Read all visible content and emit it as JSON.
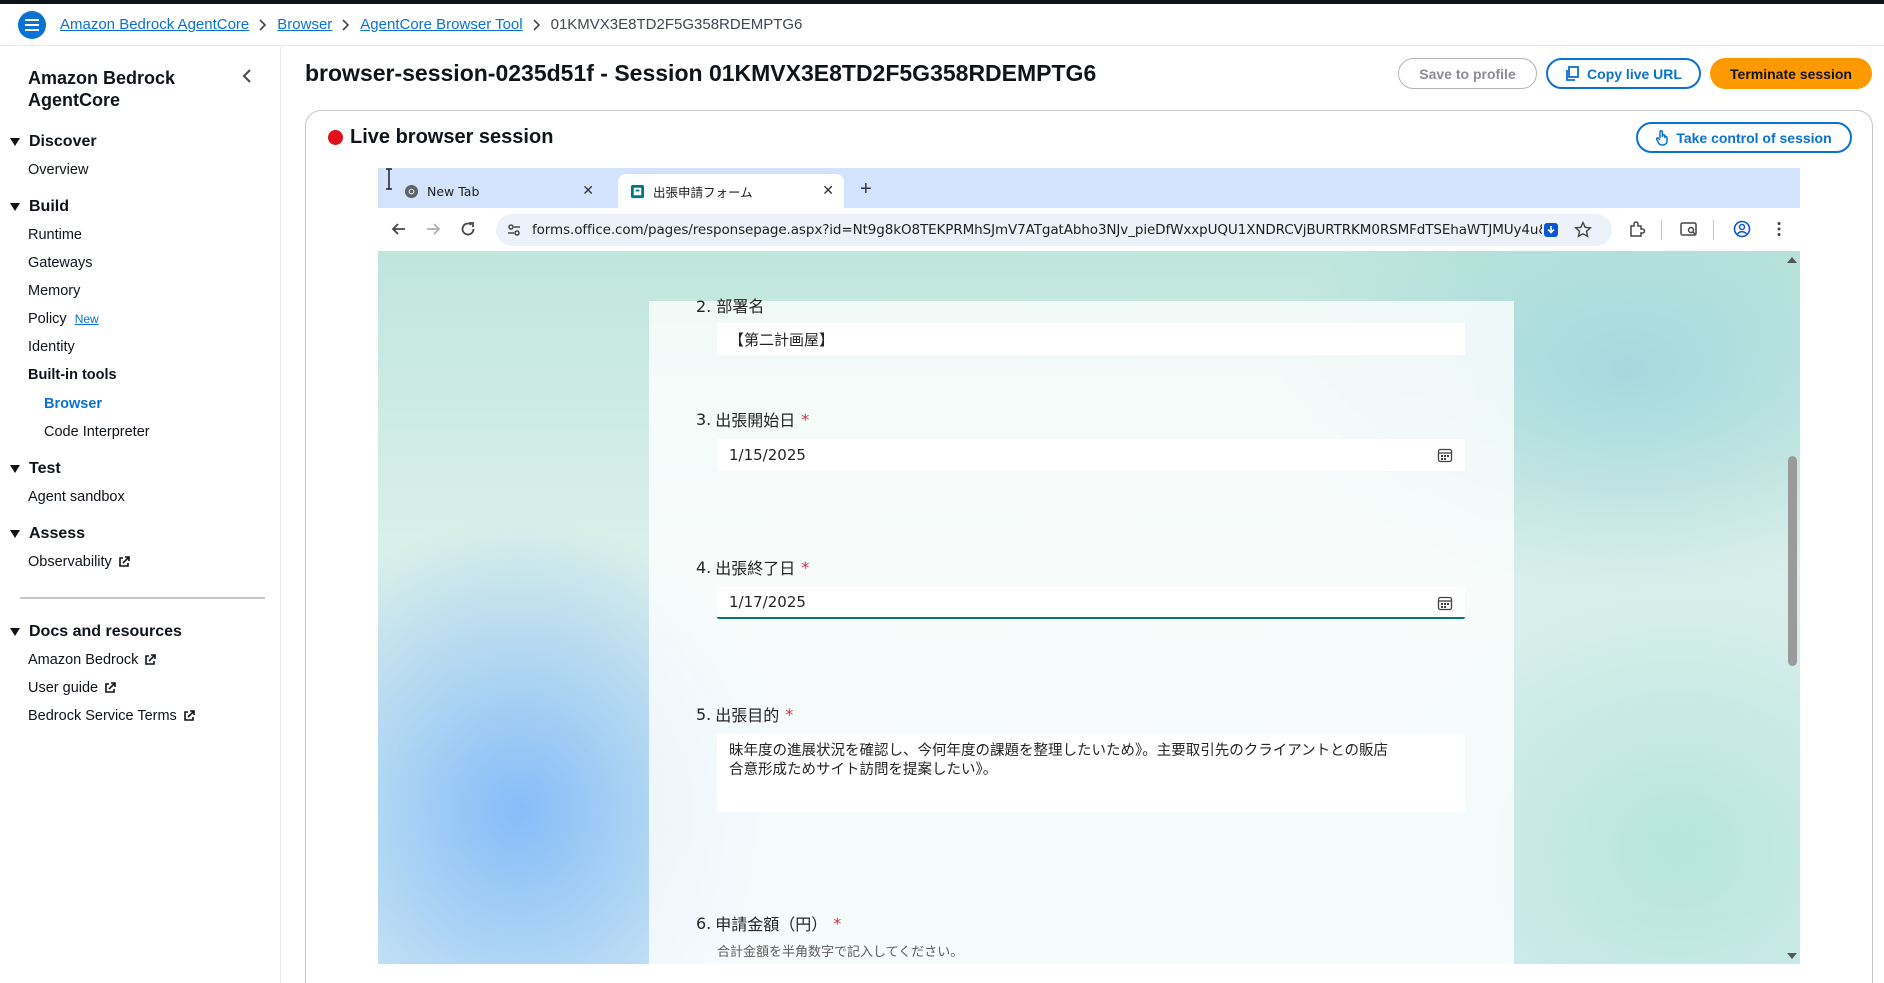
{
  "breadcrumbs": {
    "items": [
      "Amazon Bedrock AgentCore",
      "Browser",
      "AgentCore Browser Tool"
    ],
    "current": "01KMVX3E8TD2F5G358RDEMPTG6"
  },
  "sidebar": {
    "title": "Amazon Bedrock AgentCore",
    "sections": {
      "discover": {
        "label": "Discover",
        "items": [
          "Overview"
        ]
      },
      "build": {
        "label": "Build",
        "items": [
          "Runtime",
          "Gateways",
          "Memory",
          "Policy",
          "Identity",
          "Built-in tools",
          "Browser",
          "Code Interpreter"
        ],
        "policy_badge": "New"
      },
      "test": {
        "label": "Test",
        "items": [
          "Agent sandbox"
        ]
      },
      "assess": {
        "label": "Assess",
        "items": [
          "Observability"
        ]
      },
      "docs": {
        "label": "Docs and resources",
        "items": [
          "Amazon Bedrock",
          "User guide",
          "Bedrock Service Terms"
        ]
      }
    }
  },
  "page": {
    "title": "browser-session-0235d51f - Session 01KMVX3E8TD2F5G358RDEMPTG6",
    "buttons": {
      "save": "Save to profile",
      "copy": "Copy live URL",
      "terminate": "Terminate session"
    }
  },
  "panel": {
    "title": "Live browser session",
    "take_control": "Take control of session"
  },
  "browser": {
    "tabs": [
      {
        "title": "New Tab",
        "icon": "chrome-icon"
      },
      {
        "title": "出張申請フォーム",
        "icon": "ms-forms-icon"
      }
    ],
    "url": "forms.office.com/pages/responsepage.aspx?id=Nt9g8kO8TEKPRMhSJmV7ATgatAbho3NJv_pieDfWxxpUQU1XNDRCVjBURTRKM0RSMFdTSEhaWTJMUy4u&r..."
  },
  "form": {
    "clipped_label": "2. 部署名",
    "q2_value": "【第二計画屋】",
    "q3": {
      "num": "3.",
      "label": "出張開始日",
      "value": "1/15/2025"
    },
    "q4": {
      "num": "4.",
      "label": "出張終了日",
      "value": "1/17/2025"
    },
    "q5": {
      "num": "5.",
      "label": "出張目的",
      "line1": "昧年度の進展状況を確認し、今何年度の課題を整理したいため》。主要取引先のクライアントとの販店",
      "line2": "合意形成ためサイト訪問を提案したい》。"
    },
    "q6": {
      "num": "6.",
      "label": "申請金額（円）",
      "hint": "合計金額を半角数字で記入してください。"
    },
    "required_mark": "*"
  },
  "colors": {
    "accent": "#0972d3",
    "terminate": "#ff9900",
    "live": "#e0101b",
    "focus": "#03787c",
    "required": "#c4314b"
  }
}
